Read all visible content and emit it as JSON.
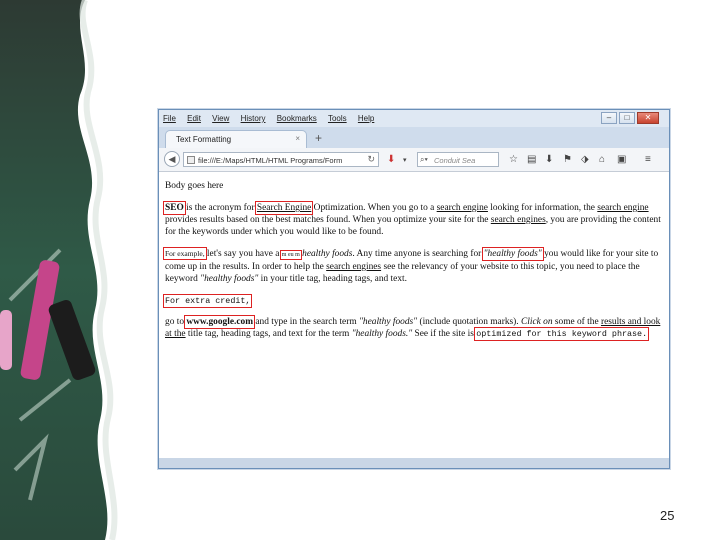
{
  "menubar": {
    "items": [
      "File",
      "Edit",
      "View",
      "History",
      "Bookmarks",
      "Tools",
      "Help"
    ],
    "minimize_icon": "minimize-icon",
    "maximize_icon": "maximize-icon",
    "close_icon": "close-icon"
  },
  "tab": {
    "title": "Text Formatting",
    "new_tab": "+"
  },
  "navbar": {
    "url": "file:///E:/Maps/HTML/HTML Programs/Form",
    "search_placeholder": "Conduit Sea",
    "icons": [
      "back-icon",
      "reload-icon",
      "download-arrow-icon",
      "search-engine-icon",
      "star-icon",
      "reading-list-icon",
      "download-icon",
      "home-icon",
      "menu-icon"
    ]
  },
  "content": {
    "intro": "Body goes here",
    "p1": {
      "seo": "SEO",
      "t1": " is the acronym for ",
      "sel": "Search Engine",
      "t2": " Optimization. When you go to a ",
      "se1": "search engine",
      "t3": " looking for information, the ",
      "se2": "search engine",
      "t4": " provides results based on the best matches found. When you optimize your site for the ",
      "se3": "search engines",
      "t5": ", you are providing the content for the keywords under which you would like to be found."
    },
    "p2": {
      "for_example": "For example,",
      "t1": " let's say you have a ",
      "small_box": "m eu m",
      "hf1": " healthy foods",
      "t2": ". Any time anyone is searching for ",
      "hf2": "\"healthy foods\"",
      "t3": " you would like for your site to come up in the results. In order to help the ",
      "se4": "search engines",
      "t4": " see the relevancy of your website to this topic, you need to place the keyword ",
      "hf3": "\"healthy foods\"",
      "t5": " in your title tag, heading tags, and text."
    },
    "extra_credit": "For extra credit,",
    "p3": {
      "t1": "go to ",
      "google": "www.google.com",
      "t2": " and type in the search term ",
      "hf4": "\"healthy foods\"",
      "t3": " (include quotation marks). ",
      "click_on": "Click on",
      "t4": " some of the ",
      "results": "results and look at the",
      "t5": " title tag, heading tags, and text for the term ",
      "hf5": "\"healthy foods.\"",
      "t6": " See if the site is ",
      "opt": "optimized for this keyword phrase."
    }
  },
  "slide_number": "25"
}
